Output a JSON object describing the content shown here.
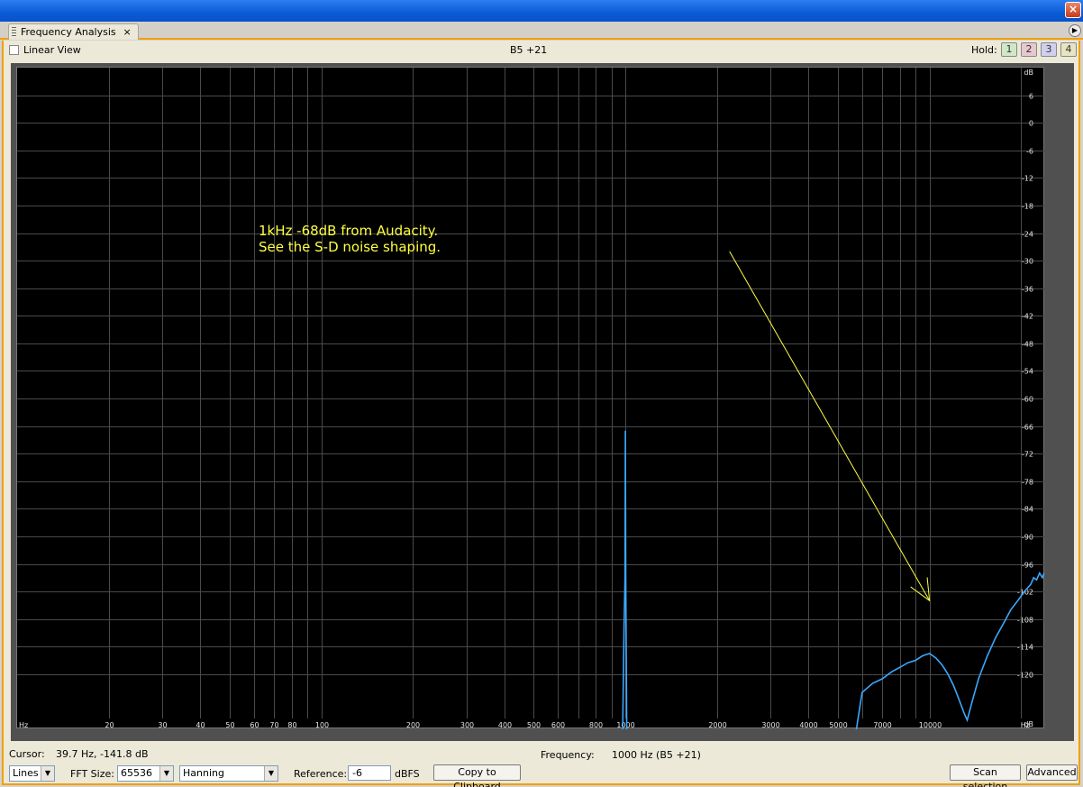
{
  "window": {
    "close_glyph": "×"
  },
  "tab": {
    "label": "Frequency Analysis",
    "close_glyph": "×",
    "menu_glyph": "▶"
  },
  "toolbar": {
    "linear_view_label": "Linear View",
    "note_readout": "B5 +21",
    "hold_label": "Hold:",
    "hold_buttons": [
      {
        "label": "1",
        "color": "#cfe8c8"
      },
      {
        "label": "2",
        "color": "#e8c8d0"
      },
      {
        "label": "3",
        "color": "#cfcfee"
      },
      {
        "label": "4",
        "color": "#e8e4c0"
      }
    ]
  },
  "chart_data": {
    "type": "line",
    "x_scale": "log",
    "xlim": [
      10,
      24000
    ],
    "ylim": [
      -132,
      12
    ],
    "x_ticks": [
      {
        "v": 20,
        "label": "20"
      },
      {
        "v": 30,
        "label": "30"
      },
      {
        "v": 40,
        "label": "40"
      },
      {
        "v": 50,
        "label": "50"
      },
      {
        "v": 60,
        "label": "60"
      },
      {
        "v": 70,
        "label": "70"
      },
      {
        "v": 80,
        "label": "80"
      },
      {
        "v": 90,
        "label": ""
      },
      {
        "v": 100,
        "label": "100",
        "major": true
      },
      {
        "v": 200,
        "label": "200"
      },
      {
        "v": 300,
        "label": "300"
      },
      {
        "v": 400,
        "label": "400"
      },
      {
        "v": 500,
        "label": "500"
      },
      {
        "v": 600,
        "label": "600"
      },
      {
        "v": 700,
        "label": ""
      },
      {
        "v": 800,
        "label": "800"
      },
      {
        "v": 900,
        "label": ""
      },
      {
        "v": 1000,
        "label": "1000",
        "major": true
      },
      {
        "v": 2000,
        "label": "2000"
      },
      {
        "v": 3000,
        "label": "3000"
      },
      {
        "v": 4000,
        "label": "4000"
      },
      {
        "v": 5000,
        "label": "5000"
      },
      {
        "v": 6000,
        "label": ""
      },
      {
        "v": 7000,
        "label": "7000"
      },
      {
        "v": 8000,
        "label": ""
      },
      {
        "v": 9000,
        "label": ""
      },
      {
        "v": 10000,
        "label": "10000",
        "major": true
      },
      {
        "v": 20000,
        "label": ""
      }
    ],
    "x_unit_left": "Hz",
    "x_unit_right": "Hz",
    "y_ticks": [
      6,
      0,
      -6,
      -12,
      -18,
      -24,
      -30,
      -36,
      -42,
      -48,
      -54,
      -60,
      -66,
      -72,
      -78,
      -84,
      -90,
      -96,
      -102,
      -108,
      -114,
      -120
    ],
    "y_unit_top": "dB",
    "y_unit_bottom": "dB",
    "series": [
      {
        "color": "#3aa8ff",
        "points": [
          [
            980,
            -132
          ],
          [
            990,
            -110
          ],
          [
            997,
            -99
          ],
          [
            1000,
            -67
          ],
          [
            1003,
            -99
          ],
          [
            1010,
            -132
          ]
        ]
      },
      {
        "color": "#3aa8ff",
        "points": [
          [
            5750,
            -132
          ],
          [
            6000,
            -124
          ],
          [
            6500,
            -122
          ],
          [
            7000,
            -121
          ],
          [
            7500,
            -119.5
          ],
          [
            8000,
            -118.5
          ],
          [
            8500,
            -117.5
          ],
          [
            9000,
            -117
          ],
          [
            9500,
            -116
          ],
          [
            10000,
            -115.5
          ],
          [
            10500,
            -116.5
          ],
          [
            11000,
            -118
          ],
          [
            11500,
            -120
          ],
          [
            12000,
            -122.5
          ],
          [
            12500,
            -125.5
          ],
          [
            13000,
            -128.5
          ],
          [
            13300,
            -130
          ],
          [
            13800,
            -126
          ],
          [
            14500,
            -121
          ],
          [
            15500,
            -116
          ],
          [
            16500,
            -112
          ],
          [
            17500,
            -109
          ],
          [
            18500,
            -106
          ],
          [
            19500,
            -104
          ],
          [
            20500,
            -102
          ],
          [
            21500,
            -100.5
          ],
          [
            22000,
            -99
          ],
          [
            22500,
            -99.5
          ],
          [
            23000,
            -98
          ],
          [
            23500,
            -99
          ],
          [
            23800,
            -98
          ]
        ]
      }
    ],
    "annotation": {
      "lines": [
        "1kHz -68dB from Audacity.",
        "See the S-D noise shaping."
      ],
      "color": "#ffff40",
      "arrow_from": [
        2200,
        -28
      ],
      "arrow_to": [
        10000,
        -104
      ]
    }
  },
  "footer": {
    "cursor_label": "Cursor:",
    "cursor_value": "39.7 Hz, -141.8 dB",
    "frequency_label": "Frequency:",
    "frequency_value": "1000 Hz (B5 +21)",
    "mode_value": "Lines",
    "fft_label": "FFT Size:",
    "fft_value": "65536",
    "window_value": "Hanning",
    "reference_label": "Reference:",
    "reference_value": "-6",
    "reference_unit": "dBFS",
    "copy_label": "Copy to Clipboard",
    "scan_label": "Scan selection",
    "advanced_label": "Advanced"
  }
}
